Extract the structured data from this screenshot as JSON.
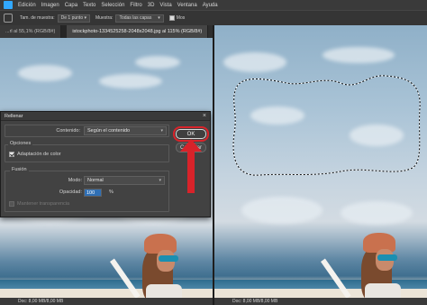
{
  "menubar": {
    "items": [
      "Edición",
      "Imagen",
      "Capa",
      "Texto",
      "Selección",
      "Filtro",
      "3D",
      "Vista",
      "Ventana",
      "Ayuda"
    ]
  },
  "options_bar": {
    "sample_size_label": "Tam. de muestra:",
    "sample_size_value": "De 1 punto",
    "sample_label": "Muestra:",
    "sample_value": "Todas las capas",
    "partial_label": "Mos"
  },
  "left_doc": {
    "tabs": [
      {
        "label": "...rl al 55,1% (RGB/8#)",
        "active": false
      },
      {
        "label": "istockphoto-1334525258-2048x2048.jpg al 115% (RGB/8#)",
        "active": true
      }
    ],
    "status": {
      "zoom": "",
      "doc": "Doc: 8,00 MB/8,00 MB"
    }
  },
  "right_doc": {
    "status": {
      "doc": "Doc: 8,00 MB/8,00 MB"
    }
  },
  "dialog": {
    "title": "Rellenar",
    "close_glyph": "×",
    "content_label": "Contenido:",
    "content_value": "Según el contenido",
    "options_group": "Opciones",
    "color_adaptation_label": "Adaptación de color",
    "color_adaptation_checked": true,
    "blending_group": "Fusión",
    "mode_label": "Modo:",
    "mode_value": "Normal",
    "opacity_label": "Opacidad:",
    "opacity_value": "100",
    "opacity_unit": "%",
    "preserve_transparency_label": "Mantener transparencia",
    "ok_label": "OK",
    "cancel_label": "Cancelar"
  },
  "colors": {
    "annotation": "#d8232a",
    "ps_blue": "#31a8ff",
    "highlight": "#2f6fb4"
  }
}
